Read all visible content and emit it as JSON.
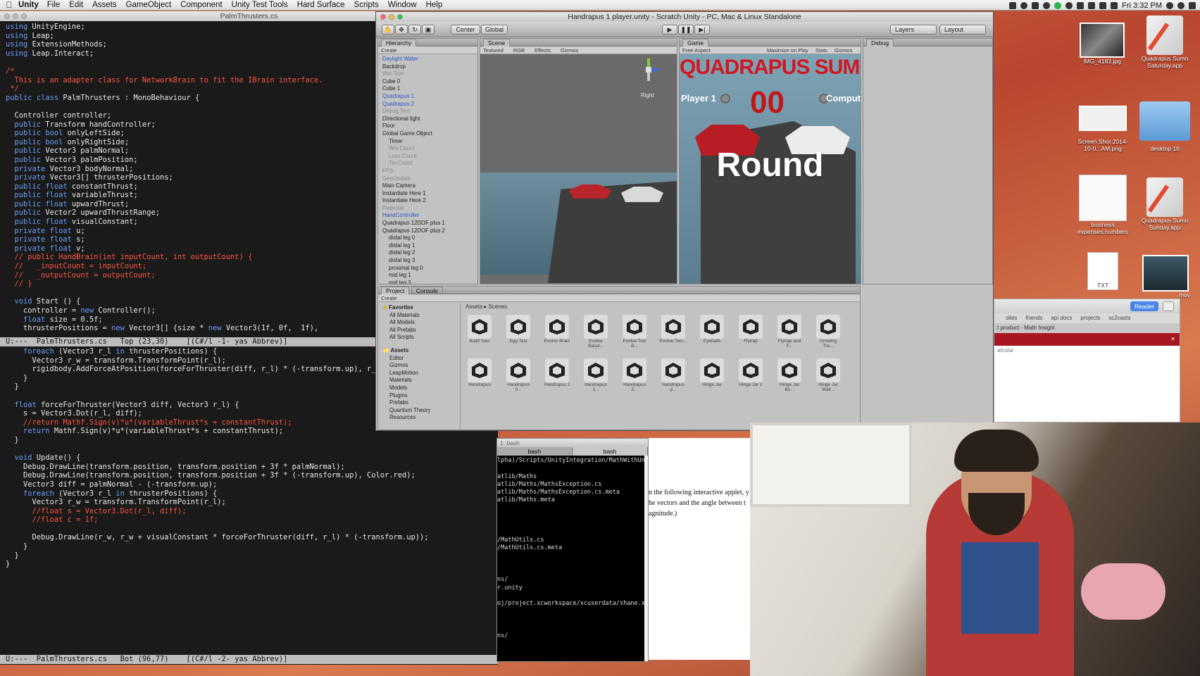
{
  "menubar": {
    "app": "Unity",
    "items": [
      "File",
      "Edit",
      "Assets",
      "GameObject",
      "Component",
      "Unity Test Tools",
      "Hard Surface",
      "Scripts",
      "Window",
      "Help"
    ],
    "clock": "Fri 3:32 PM"
  },
  "editor": {
    "title": "PalmThrusters.cs",
    "top_lines": [
      "using UnityEngine;",
      "using Leap;",
      "using ExtensionMethods;",
      "using Leap.Interact;",
      "",
      "/*",
      "  This is an adapter class for NetworkBrain to fit the IBrain interface.",
      " */",
      "public class PalmThrusters : MonoBehaviour {",
      "",
      "  Controller controller;",
      "  public Transform handController;",
      "  public bool onlyLeftSide;",
      "  public bool onlyRightSide;",
      "  public Vector3 palmNormal;",
      "  public Vector3 palmPosition;",
      "  private Vector3 bodyNormal;",
      "  private Vector3[] thrusterPositions;",
      "  public float constantThrust;",
      "  public float variableThrust;",
      "  public float upwardThrust;",
      "  public Vector2 upwardThrustRange;",
      "  public float visualConstant;",
      "  private float u;",
      "  private float s;",
      "  private float v;",
      "  // public HandBrain(int inputCount, int outputCount) {",
      "  //   _inputCount = inputCount;",
      "  //   _outputCount = outputCount;",
      "  // }",
      "",
      "  void Start () {",
      "    controller = new Controller();",
      "    float size = 0.5f;",
      "    thrusterPositions = new Vector3[] {size * new Vector3(1f, 0f,  1f),"
    ],
    "modeline_top": "U:---  PalmThrusters.cs   Top (23,30)    [(C#/l -1- yas Abbrev)]",
    "bottom_lines": [
      "    foreach (Vector3 r_l in thrusterPositions) {",
      "      Vector3 r_w = transform.TransformPoint(r_l);",
      "      rigidbody.AddForceAtPosition(forceForThruster(diff, r_l) * (-transform.up), r_w);",
      "    }",
      "  }",
      "",
      "  float forceForThruster(Vector3 diff, Vector3 r_l) {",
      "    s = Vector3.Dot(r_l, diff);",
      "    //return Mathf.Sign(v)*u*(variableThrust*s + constantThrust);",
      "    return Mathf.Sign(v)*u*(variableThrust*s + constantThrust);",
      "  }",
      "",
      "  void Update() {",
      "    Debug.DrawLine(transform.position, transform.position + 3f * palmNormal);",
      "    Debug.DrawLine(transform.position, transform.position + 3f * (-transform.up), Color.red);",
      "    Vector3 diff = palmNormal - (-transform.up);",
      "    foreach (Vector3 r_l in thrusterPositions) {",
      "      Vector3 r_w = transform.TransformPoint(r_l);",
      "      //float s = Vector3.Dot(r_l, diff);",
      "      //float c = 1f;",
      "",
      "      Debug.DrawLine(r_w, r_w + visualConstant * forceForThruster(diff, r_l) * (-transform.up));",
      "    }",
      "  }",
      "}"
    ],
    "modeline_bottom": "U:---  PalmThrusters.cs   Bot (96,77)    [(C#/l -2- yas Abbrev)]"
  },
  "unity": {
    "title": "Handrapus 1 player.unity - Scratch Unity - PC, Mac & Linux Standalone",
    "toolbar": {
      "center": "Center",
      "global": "Global",
      "layers": "Layers",
      "layout": "Layout"
    },
    "hierarchy": {
      "tab": "Hierarchy",
      "create": "Create",
      "items": [
        {
          "label": "Daylight Water",
          "style": "blue",
          "indent": 0
        },
        {
          "label": "Backdrop",
          "style": "",
          "indent": 0
        },
        {
          "label": "Win Text",
          "style": "grey",
          "indent": 0
        },
        {
          "label": "Cube 0",
          "style": "",
          "indent": 0
        },
        {
          "label": "Cube 1",
          "style": "",
          "indent": 0
        },
        {
          "label": "Quadrapus 1",
          "style": "blue",
          "indent": 0
        },
        {
          "label": "Quadrapus 2",
          "style": "blue",
          "indent": 0
        },
        {
          "label": "Debug Text",
          "style": "grey",
          "indent": 0
        },
        {
          "label": "Directional light",
          "style": "",
          "indent": 0
        },
        {
          "label": "Floor",
          "style": "",
          "indent": 0
        },
        {
          "label": "Global Game Object",
          "style": "",
          "indent": 0
        },
        {
          "label": "Timer",
          "style": "",
          "indent": 1
        },
        {
          "label": "Win Count",
          "style": "grey",
          "indent": 1
        },
        {
          "label": "Loss Count",
          "style": "grey",
          "indent": 1
        },
        {
          "label": "Tie Count",
          "style": "grey",
          "indent": 1
        },
        {
          "label": "FPS",
          "style": "grey",
          "indent": 0
        },
        {
          "label": "GenUpdate",
          "style": "grey",
          "indent": 0
        },
        {
          "label": "Main Camera",
          "style": "",
          "indent": 0
        },
        {
          "label": "Instantiate Here 1",
          "style": "",
          "indent": 0
        },
        {
          "label": "Instantiate Here 2",
          "style": "",
          "indent": 0
        },
        {
          "label": "Pedestal",
          "style": "grey",
          "indent": 0
        },
        {
          "label": "HandController",
          "style": "blue",
          "indent": 0
        },
        {
          "label": "Quadrapus 12DOF plus 1",
          "style": "",
          "indent": 0
        },
        {
          "label": "Quadrapus 12DOF plus 2",
          "style": "",
          "indent": 0
        },
        {
          "label": "distal leg 0",
          "style": "",
          "indent": 1
        },
        {
          "label": "distal leg 1",
          "style": "",
          "indent": 1
        },
        {
          "label": "distal leg 2",
          "style": "",
          "indent": 1
        },
        {
          "label": "distal leg 3",
          "style": "",
          "indent": 1
        },
        {
          "label": "proximal leg 0",
          "style": "",
          "indent": 1
        },
        {
          "label": "mid leg 1",
          "style": "",
          "indent": 1
        },
        {
          "label": "mid leg 3",
          "style": "",
          "indent": 1
        }
      ]
    },
    "scene": {
      "tab": "Scene",
      "textured": "Textured",
      "rgb": "RGB",
      "effects": "Effects",
      "gizmos": "Gizmos",
      "persp": "Right"
    },
    "game": {
      "tab": "Game",
      "aspect": "Free Aspect",
      "maximize": "Maximize on Play",
      "stats": "Stats",
      "gizmos": "Gizmos",
      "banner": "QUADRAPUS SUMO",
      "player1": "Player 1",
      "computer": "Computer",
      "score": "00",
      "round": "Round"
    },
    "debug_tab": "Debug",
    "project": {
      "tab": "Project",
      "console_tab": "Console",
      "create": "Create",
      "breadcrumb": [
        "Assets",
        "Scenes"
      ],
      "favorites_label": "Favorites",
      "favorites": [
        "All Materials",
        "All Models",
        "All Prefabs",
        "All Scripts"
      ],
      "assets_label": "Assets",
      "folders": [
        "Editor",
        "Gizmos",
        "LeapMotion",
        "Materials",
        "Models",
        "Plugins",
        "Prefabs",
        "Quantum Theory",
        "Resources"
      ],
      "row1": [
        "Build Your",
        "Egg Test",
        "Evolve Brain",
        "Evolve Besul...",
        "Evolve Two B...",
        "Evolve Two...",
        "Eyeballs",
        "Flytrap",
        "Flytrap and F...",
        "Growing Tre..."
      ],
      "row2": [
        "Handrapus",
        "Handrapus 0...",
        "Handrapus 1",
        "Handrapus 1...",
        "Handrapus 2...",
        "Handrapus p...",
        "Hinge Jar",
        "Hinge Jar 2",
        "Hinge Jar Bo...",
        "Hinge Jar Wall..."
      ]
    }
  },
  "terminal": {
    "title": "1. bash",
    "tabs": [
      "bash",
      "bash"
    ],
    "lines": [
      "lpha)/Scripts/UnityIntegration/MathWithUnit",
      "",
      "atlib/Maths",
      "atlib/Maths/MathsException.cs",
      "atlib/Maths/MathsException.cs.meta",
      "atlib/Maths.meta",
      "",
      "",
      "",
      "",
      "/MathUtils.cs",
      "/MathUtils.cs.meta",
      "",
      "",
      "",
      "ns/",
      "r.unity",
      "",
      "oj/project.xcworkspace/xcuserdata/shane.xc",
      "",
      "",
      "",
      "ns/"
    ]
  },
  "browser": {
    "text": [
      "n the following interactive applet, y",
      "he vectors and the angle between t",
      "agnitude.)"
    ],
    "tabs": [
      "sites",
      "friends",
      "api docs",
      "projects",
      "sc2casts"
    ],
    "reader": "Reader",
    "tabtitle": "t product - Math Insight",
    "snippet": "alcular"
  },
  "desktop_icons": [
    {
      "label": "IMG_4183.jpg"
    },
    {
      "label": "Quadrapus Sumo Saturday.app"
    },
    {
      "label": "Screen Shot 2014-10-0...AM.png"
    },
    {
      "label": "desktop 16"
    },
    {
      "label": "business expenses.numbers"
    },
    {
      "label": "Quadrapus Sumo Sunday.app"
    },
    {
      "label": "TXT"
    },
    {
      "label": "mov"
    },
    {
      "label": "mov"
    }
  ]
}
